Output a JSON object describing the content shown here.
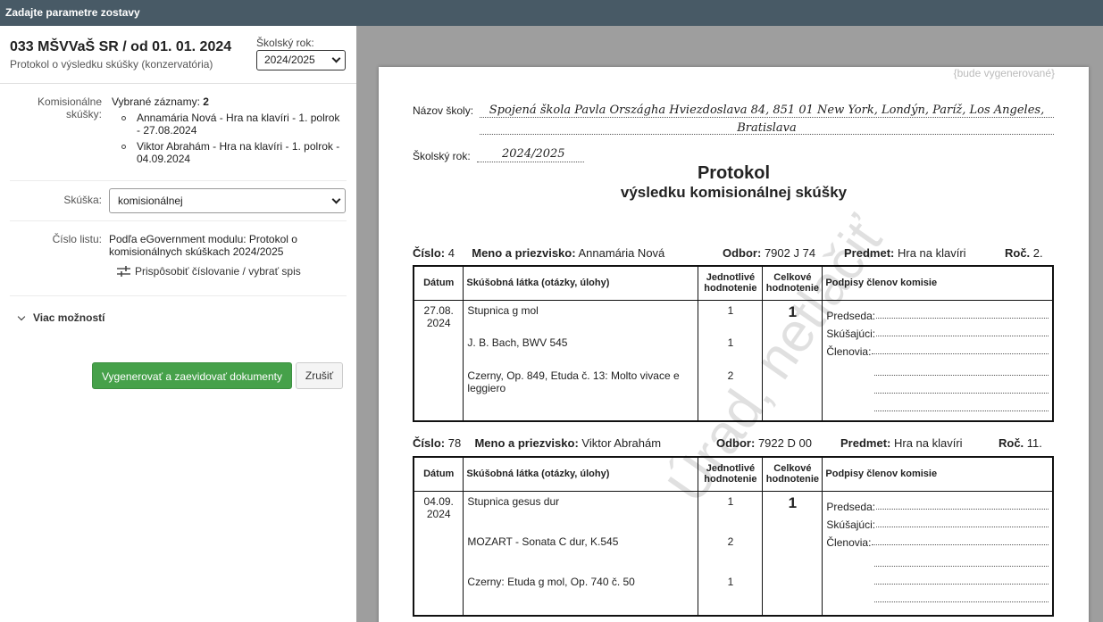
{
  "window": {
    "title": "Zadajte parametre zostavy"
  },
  "header": {
    "title": "033 MŠVVaŠ SR / od 01. 01. 2024",
    "subtitle": "Protokol o výsledku skúšky (konzervatória)",
    "school_year_label": "Školský rok:",
    "school_year_value": "2024/2025"
  },
  "form": {
    "commission_label": "Komisionálne skúšky:",
    "selected_label": "Vybrané záznamy:",
    "selected_count": "2",
    "records": [
      "Annamária Nová - Hra na klavíri - 1. polrok - 27.08.2024",
      "Viktor Abrahám - Hra na klavíri - 1. polrok - 04.09.2024"
    ],
    "exam_label": "Skúška:",
    "exam_value": "komisionálnej",
    "sheet_label": "Číslo listu:",
    "sheet_value": "Podľa eGovernment modulu: Protokol o komisionálnych skúškach 2024/2025",
    "customize_label": "Prispôsobiť číslovanie / vybrať spis",
    "more_options": "Viac možností",
    "generate_button": "Vygenerovať a zaevidovať dokumenty",
    "cancel_button": "Zrušiť"
  },
  "preview": {
    "generated_note": "{bude vygenerované}",
    "school_label": "Názov školy:",
    "school_name_line1": "Spojená škola Pavla Országha Hviezdoslava 84, 851 01 New York, Londýn, Paríž, Los Angeles,",
    "school_name_line2": "Bratislava",
    "year_label": "Školský rok:",
    "year_value": "2024/2025",
    "title": "Protokol",
    "subtitle": "výsledku komisionálnej skúšky",
    "watermark": "Úrad, netlačiť",
    "labels": {
      "number": "Číslo:",
      "name": "Meno a priezvisko:",
      "dept": "Odbor:",
      "subject": "Predmet:",
      "year": "Roč."
    },
    "columns": {
      "date": "Dátum",
      "subject": "Skúšobná látka (otázky, úlohy)",
      "individual_1": "Jednotlivé",
      "individual_2": "hodnotenie",
      "total_1": "Celkové",
      "total_2": "hodnotenie",
      "signatures": "Podpisy členov komisie"
    },
    "signature_labels": {
      "chair": "Predseda:",
      "examiner": "Skúšajúci:",
      "members": "Členovia:"
    },
    "protocols": [
      {
        "number": "4",
        "name": "Annamária Nová",
        "dept": "7902 J 74",
        "subject": "Hra na klavíri",
        "year": "2.",
        "date_1": "27.08.",
        "date_2": "2024",
        "items": [
          {
            "text": "Stupnica g mol",
            "grade": "1"
          },
          {
            "text": "J. B. Bach, BWV 545",
            "grade": "1"
          },
          {
            "text": "Czerny, Op. 849, Etuda č. 13: Molto vivace e leggiero",
            "grade": "2"
          }
        ],
        "total": "1"
      },
      {
        "number": "78",
        "name": "Viktor Abrahám",
        "dept": "7922 D 00",
        "subject": "Hra na klavíri",
        "year": "11.",
        "date_1": "04.09.",
        "date_2": "2024",
        "items": [
          {
            "text": "Stupnica gesus dur",
            "grade": "1"
          },
          {
            "text": "MOZART - Sonata C dur, K.545",
            "grade": "2"
          },
          {
            "text": "Czerny: Etuda g mol, Op. 740 č. 50",
            "grade": "1"
          }
        ],
        "total": "1"
      }
    ]
  }
}
